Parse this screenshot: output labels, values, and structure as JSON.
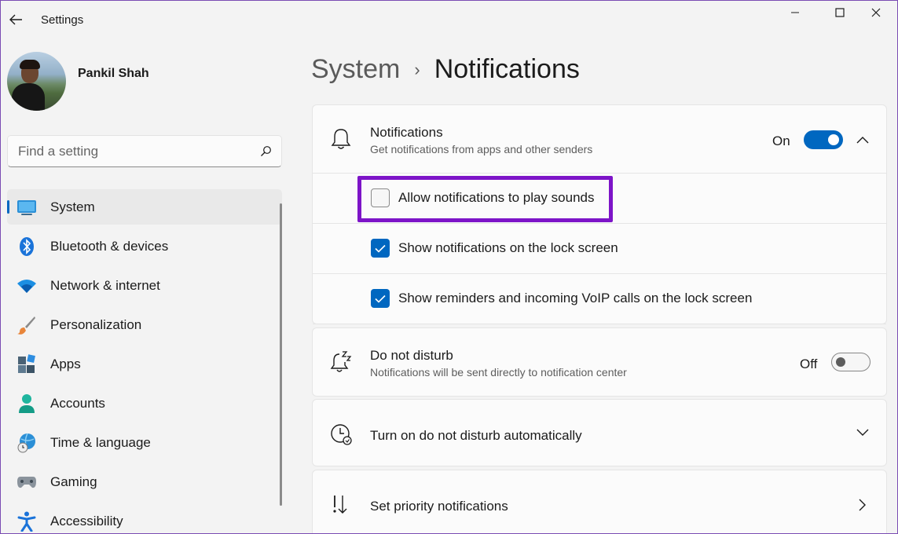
{
  "window": {
    "title": "Settings"
  },
  "profile": {
    "name": "Pankil Shah"
  },
  "search": {
    "placeholder": "Find a setting"
  },
  "nav": {
    "items": [
      {
        "label": "System",
        "icon": "system-icon",
        "active": true
      },
      {
        "label": "Bluetooth & devices",
        "icon": "bluetooth-icon"
      },
      {
        "label": "Network & internet",
        "icon": "wifi-icon"
      },
      {
        "label": "Personalization",
        "icon": "brush-icon"
      },
      {
        "label": "Apps",
        "icon": "apps-icon"
      },
      {
        "label": "Accounts",
        "icon": "accounts-icon"
      },
      {
        "label": "Time & language",
        "icon": "globe-clock-icon"
      },
      {
        "label": "Gaming",
        "icon": "gamepad-icon"
      },
      {
        "label": "Accessibility",
        "icon": "accessibility-icon"
      }
    ]
  },
  "breadcrumb": {
    "parent": "System",
    "separator": "›",
    "current": "Notifications"
  },
  "notifications": {
    "title": "Notifications",
    "subtitle": "Get notifications from apps and other senders",
    "state": "On",
    "options": [
      {
        "label": "Allow notifications to play sounds",
        "checked": false,
        "highlighted": true
      },
      {
        "label": "Show notifications on the lock screen",
        "checked": true
      },
      {
        "label": "Show reminders and incoming VoIP calls on the lock screen",
        "checked": true
      }
    ]
  },
  "do_not_disturb": {
    "title": "Do not disturb",
    "subtitle": "Notifications will be sent directly to notification center",
    "state": "Off"
  },
  "auto_dnd": {
    "title": "Turn on do not disturb automatically"
  },
  "priority": {
    "title": "Set priority notifications"
  },
  "colors": {
    "accent": "#0067c0",
    "highlight_border": "#7d14c8",
    "background": "#f3f3f3",
    "card": "#fbfbfb"
  }
}
